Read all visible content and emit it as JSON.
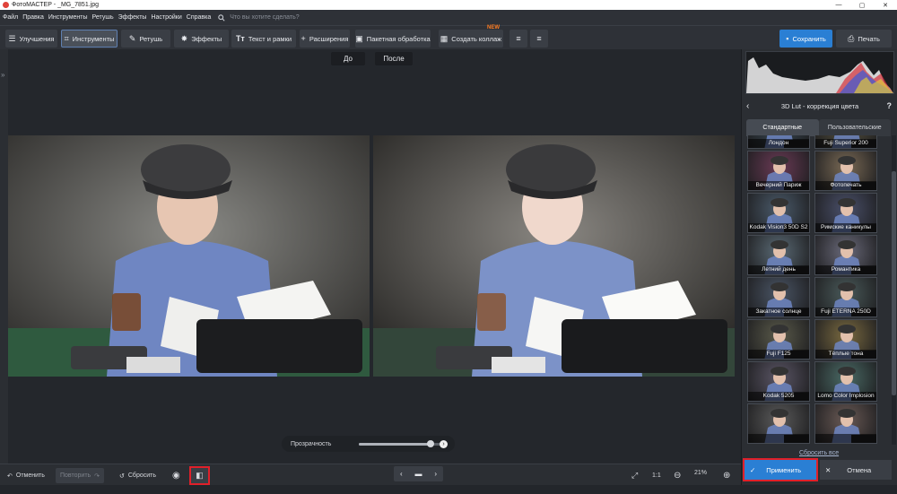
{
  "window": {
    "title": "ФотоМАСТЕР - _MG_7851.jpg",
    "min": "—",
    "max": "▢",
    "close": "✕"
  },
  "menu": {
    "items": [
      "Файл",
      "Правка",
      "Инструменты",
      "Ретушь",
      "Эффекты",
      "Настройки",
      "Справка"
    ],
    "search_placeholder": "Что вы хотите сделать?"
  },
  "toolbar": {
    "tabs": [
      "Улучшения",
      "Инструменты",
      "Ретушь",
      "Эффекты",
      "Текст и рамки",
      "Расширения"
    ],
    "batch": "Пакетная обработка",
    "collage": "Создать коллаж",
    "new_badge": "NEW",
    "save": "Сохранить",
    "print": "Печать"
  },
  "view": {
    "before": "До",
    "after": "После"
  },
  "transparency": {
    "label": "Прозрачность",
    "value_percent": 85
  },
  "bottom": {
    "undo": "Отменить",
    "redo": "Повторить",
    "reset": "Сбросить",
    "ratio": "1:1",
    "zoom": "21%"
  },
  "panel": {
    "title": "3D Lut - коррекция цвета",
    "tabs": [
      "Стандартные",
      "Пользовательские"
    ],
    "luts": [
      {
        "name": "Лондон",
        "tint": "#3a4a55"
      },
      {
        "name": "Fuji Superior 200",
        "tint": "#5a5540"
      },
      {
        "name": "Вечерний Париж",
        "tint": "#6a3a55"
      },
      {
        "name": "Фотопечать",
        "tint": "#7a6a55"
      },
      {
        "name": "Kodak Vision3 50D S2",
        "tint": "#4a5a6a"
      },
      {
        "name": "Римские каникулы",
        "tint": "#4a506a"
      },
      {
        "name": "Летний день",
        "tint": "#5a6a75"
      },
      {
        "name": "Романтика",
        "tint": "#6a6a7a"
      },
      {
        "name": "Закатное солнце",
        "tint": "#4a5565"
      },
      {
        "name": "Fuji ETERNA 250D",
        "tint": "#4a5a5a"
      },
      {
        "name": "Fuji F125",
        "tint": "#5a5a4a"
      },
      {
        "name": "Тёплые тона",
        "tint": "#7a6a40"
      },
      {
        "name": "Kodak 5205",
        "tint": "#5a5565"
      },
      {
        "name": "Lomo Color Implosion",
        "tint": "#4a6a65"
      },
      {
        "name": "",
        "tint": "#5a5a5a"
      },
      {
        "name": "",
        "tint": "#6a5a55"
      }
    ],
    "reset_all": "Сбросить все",
    "apply": "Применить",
    "cancel": "Отмена"
  }
}
